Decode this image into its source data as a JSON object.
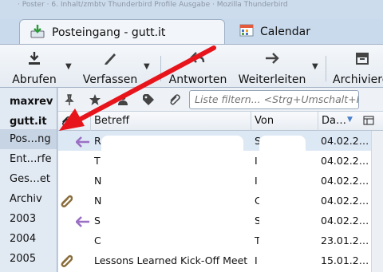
{
  "window": {
    "title_fragment": "· Poster · 6. Inhalt/zmbtv Thunderbird Profile Ausgabe · Mozilla Thunderbird"
  },
  "tabs": [
    {
      "label": "Posteingang - gutt.it",
      "icon": "inbox-download-icon",
      "active": true
    },
    {
      "label": "Calendar",
      "icon": "calendar-icon",
      "active": false
    }
  ],
  "toolbar": {
    "get_messages": "Abrufen",
    "write": "Verfassen",
    "reply": "Antworten",
    "forward": "Weiterleiten",
    "archive": "Archivieren"
  },
  "folders": [
    {
      "label": "maxrev",
      "bold": true,
      "selected": false,
      "interactable": true
    },
    {
      "label": "gutt.it",
      "bold": true,
      "selected": false,
      "interactable": true
    },
    {
      "label": "Pos…ng",
      "bold": false,
      "selected": true,
      "interactable": true
    },
    {
      "label": "Ent…rfe",
      "bold": false,
      "selected": false,
      "interactable": true
    },
    {
      "label": "Ges…et",
      "bold": false,
      "selected": false,
      "interactable": true
    },
    {
      "label": "Archiv",
      "bold": false,
      "selected": false,
      "interactable": true
    },
    {
      "label": "2003",
      "bold": false,
      "selected": false,
      "interactable": true
    },
    {
      "label": "2004",
      "bold": false,
      "selected": false,
      "interactable": true
    },
    {
      "label": "2005",
      "bold": false,
      "selected": false,
      "interactable": true
    }
  ],
  "filter": {
    "placeholder": "Liste filtern... <Strg+Umschalt+K>"
  },
  "columns": {
    "subject": "Betreff",
    "from": "Von",
    "date": "Da…"
  },
  "messages": [
    {
      "attachment": false,
      "replied": true,
      "subject": "R",
      "from": "S",
      "date": "04.02.2…",
      "selected": true
    },
    {
      "attachment": false,
      "replied": false,
      "subject": "T",
      "from": "I",
      "date": "04.02.2…",
      "selected": false
    },
    {
      "attachment": false,
      "replied": false,
      "subject": "N",
      "from": "I",
      "date": "04.02.2…",
      "selected": false
    },
    {
      "attachment": true,
      "replied": false,
      "subject": "N",
      "from": "C",
      "date": "04.02.2…",
      "selected": false
    },
    {
      "attachment": false,
      "replied": true,
      "subject": "S",
      "from": "S",
      "date": "04.02.2…",
      "selected": false
    },
    {
      "attachment": false,
      "replied": false,
      "subject": "C",
      "from": "T",
      "date": "23.01.2…",
      "selected": false
    },
    {
      "attachment": true,
      "replied": false,
      "subject": "Lessons Learned Kick-Off Meeting",
      "from": "I",
      "date": "15.01.2…",
      "selected": false
    }
  ],
  "colors": {
    "annotation_arrow": "#e8141b",
    "replied_arrow": "#9b6fc4",
    "attachment_clip": "#8a6d3b"
  }
}
